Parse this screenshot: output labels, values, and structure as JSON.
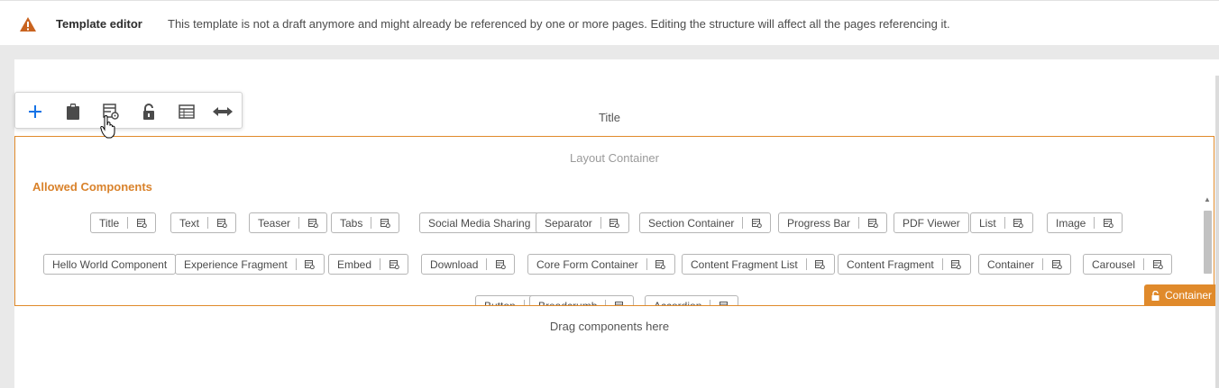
{
  "banner": {
    "icon": "warning-icon",
    "title": "Template editor",
    "message": "This template is not a draft anymore and might already be referenced by one or more pages. Editing the structure will affect all the pages referencing it."
  },
  "toolbar": {
    "buttons": [
      "add-icon",
      "paste-icon",
      "policy-icon",
      "unlock-icon",
      "table-icon",
      "resize-icon"
    ]
  },
  "title_component": "Title",
  "layout_container": {
    "label": "Layout Container",
    "allowed_title": "Allowed Components",
    "row1": [
      "Title",
      "Text",
      "Teaser",
      "Tabs",
      "Social Media Sharing",
      "Separator",
      "Section Container",
      "Progress Bar",
      "PDF Viewer",
      "List",
      "Image"
    ],
    "row2": [
      "Hello World Component",
      "Experience Fragment",
      "Embed",
      "Download",
      "Core Form Container",
      "Content Fragment List",
      "Content Fragment",
      "Container",
      "Carousel"
    ],
    "row3": [
      "Button",
      "Breadcrumb",
      "Accordion"
    ]
  },
  "container_badge": "Container",
  "drag_hint": "Drag components here",
  "colors": {
    "accent": "#e08a2b",
    "warning": "#c9631f",
    "toolbar_blue": "#1473e6"
  }
}
